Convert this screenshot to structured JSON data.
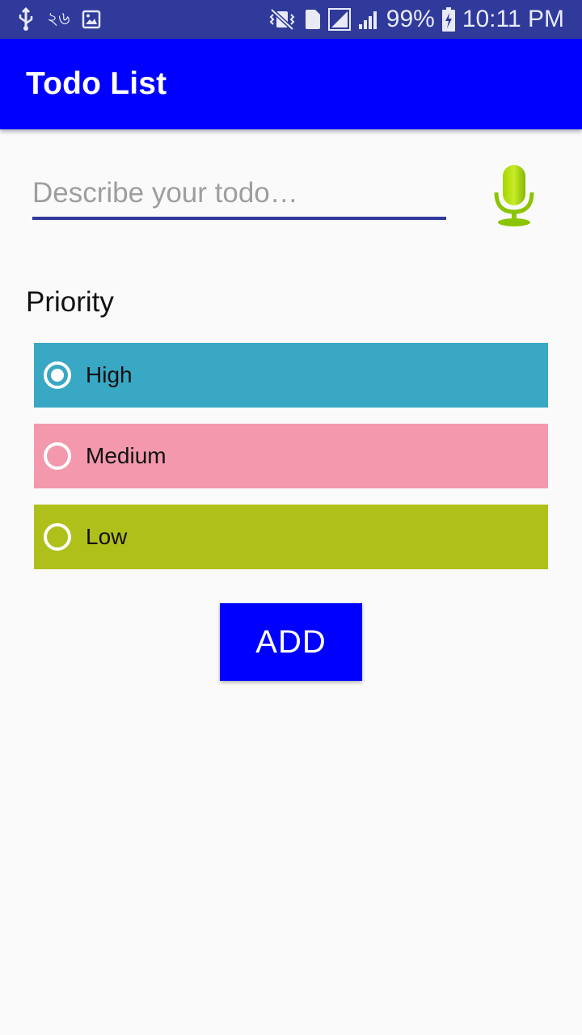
{
  "status_bar": {
    "notification_text": "২৬",
    "battery_percent": "99%",
    "time": "10:11 PM",
    "sim_slot": "1",
    "icons": [
      "usb-icon",
      "image-notification-icon",
      "vibrate-icon",
      "sim-icon",
      "signal-icon",
      "signal-icon",
      "battery-charging-icon"
    ]
  },
  "app_bar": {
    "title": "Todo List",
    "color": "#0000ff"
  },
  "todo_input": {
    "value": "",
    "placeholder": "Describe your todo…",
    "mic_icon": "microphone-icon",
    "mic_color": "#8bc400"
  },
  "priority": {
    "label": "Priority",
    "selected": "High",
    "options": [
      {
        "label": "High",
        "color": "#39a8c4",
        "checked": true
      },
      {
        "label": "Medium",
        "color": "#f398ad",
        "checked": false
      },
      {
        "label": "Low",
        "color": "#b0c01a",
        "checked": false
      }
    ]
  },
  "add_button": {
    "label": "ADD",
    "color": "#0000ff"
  }
}
